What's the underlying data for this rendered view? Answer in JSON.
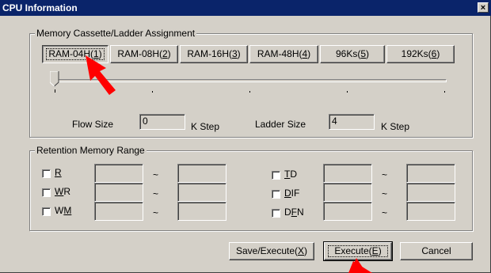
{
  "window": {
    "title": "CPU Information",
    "close_glyph": "×"
  },
  "memory_group": {
    "label": "Memory Cassette/Ladder Assignment",
    "tabs": [
      {
        "label": "RAM-04H(",
        "key": "1",
        "suffix": ")"
      },
      {
        "label": "RAM-08H(",
        "key": "2",
        "suffix": ")"
      },
      {
        "label": "RAM-16H(",
        "key": "3",
        "suffix": ")"
      },
      {
        "label": "RAM-48H(",
        "key": "4",
        "suffix": ")"
      },
      {
        "label": "96Ks(",
        "key": "5",
        "suffix": ")"
      },
      {
        "label": "192Ks(",
        "key": "6",
        "suffix": ")"
      }
    ],
    "slider_position": 0,
    "flow_size_label": "Flow Size",
    "flow_size_value": "0",
    "flow_unit": "K Step",
    "ladder_size_label": "Ladder Size",
    "ladder_size_value": "4",
    "ladder_unit": "K Step"
  },
  "retention_group": {
    "label": "Retention Memory Range",
    "tilde": "~",
    "left_rows": [
      {
        "pre": "",
        "key": "R",
        "post": ""
      },
      {
        "pre": "",
        "key": "W",
        "post": "R"
      },
      {
        "pre": "W",
        "key": "M",
        "post": ""
      }
    ],
    "right_rows": [
      {
        "pre": "",
        "key": "T",
        "post": "D"
      },
      {
        "pre": "",
        "key": "D",
        "post": "IF"
      },
      {
        "pre": "D",
        "key": "F",
        "post": "N"
      }
    ]
  },
  "buttons": {
    "save_execute": {
      "label": "Save/Execute(",
      "key": "X",
      "suffix": ")"
    },
    "execute": {
      "label": "Execute(",
      "key": "E",
      "suffix": ")"
    },
    "cancel": {
      "label": "Cancel"
    }
  },
  "colors": {
    "titlebar": "#0a246a",
    "face": "#d4d0c8",
    "annotation_arrow": "#ff0000"
  }
}
